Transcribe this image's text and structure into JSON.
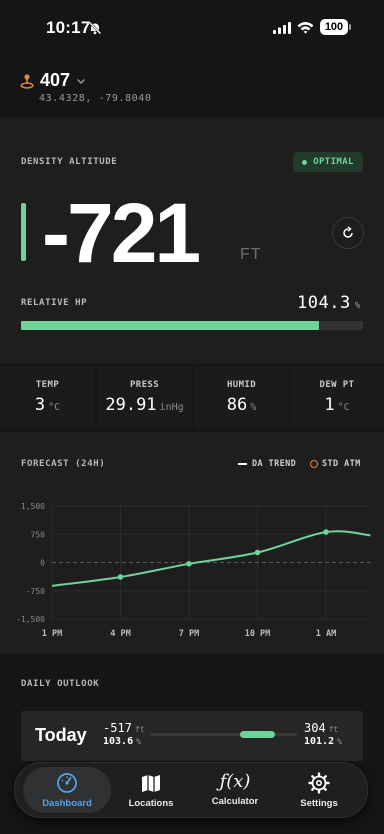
{
  "status_bar": {
    "time": "10:17",
    "battery": "100"
  },
  "location": {
    "name": "407",
    "coords": "43.4328, -79.8040"
  },
  "density": {
    "label": "DENSITY ALTITUDE",
    "status": "OPTIMAL",
    "value": "-721",
    "unit": "FT",
    "relative_hp_label": "RELATIVE HP",
    "relative_hp_value": "104.3",
    "relative_hp_unit": "%",
    "relative_hp_fill_fraction": 0.87,
    "accent_color": "#6fd39a"
  },
  "conditions": [
    {
      "label": "TEMP",
      "value": "3",
      "unit": "°C"
    },
    {
      "label": "PRESS",
      "value": "29.91",
      "unit": "inHg"
    },
    {
      "label": "HUMID",
      "value": "86",
      "unit": "%"
    },
    {
      "label": "DEW PT",
      "value": "1",
      "unit": "°C"
    }
  ],
  "forecast": {
    "title": "FORECAST (24H)",
    "legend_trend": "DA TREND",
    "legend_std": "STD ATM"
  },
  "chart_data": {
    "type": "line",
    "x": [
      "1 PM",
      "4 PM",
      "7 PM",
      "10 PM",
      "1 AM"
    ],
    "ylim": [
      -1500,
      1500
    ],
    "yticks": [
      "1,500",
      "750",
      "0",
      "-750",
      "-1,500"
    ],
    "series": [
      {
        "name": "DA TREND",
        "points": [
          [
            0,
            -620
          ],
          [
            1,
            -385
          ],
          [
            2,
            -35
          ],
          [
            3,
            265
          ],
          [
            4,
            810
          ],
          [
            4.65,
            720
          ]
        ],
        "markers": [
          [
            1,
            -385
          ],
          [
            2,
            -35
          ],
          [
            3,
            265
          ],
          [
            4,
            810
          ]
        ]
      },
      {
        "name": "STD ATM",
        "points": [
          [
            0,
            0
          ],
          [
            4.65,
            0
          ]
        ]
      }
    ]
  },
  "daily": {
    "title": "DAILY OUTLOOK",
    "today": {
      "day": "Today",
      "low_da": "-517",
      "low_unit": "ft",
      "low_hp": "103.6",
      "low_hp_unit": "%",
      "high_da": "304",
      "high_unit": "ft",
      "high_hp": "101.2",
      "high_hp_unit": "%"
    }
  },
  "tabs": [
    {
      "label": "Dashboard",
      "icon": "gauge-icon",
      "active": true
    },
    {
      "label": "Locations",
      "icon": "map-icon",
      "active": false
    },
    {
      "label": "Calculator",
      "icon": "function-icon",
      "active": false
    },
    {
      "label": "Settings",
      "icon": "gear-icon",
      "active": false
    }
  ],
  "colors": {
    "accent": "#6fd39a",
    "active_tab": "#5aa2e6",
    "std_atm": "#e08a3c"
  }
}
